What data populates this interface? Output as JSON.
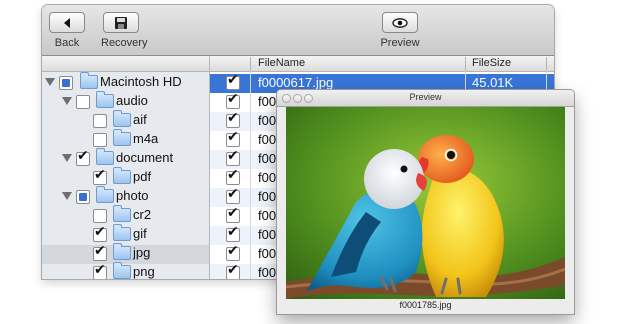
{
  "toolbar": {
    "back_label": "Back",
    "recovery_label": "Recovery",
    "preview_label": "Preview"
  },
  "tree": [
    {
      "label": "Macintosh HD",
      "expanded": true,
      "check": "partial"
    },
    {
      "label": "audio",
      "expanded": true,
      "check": "none"
    },
    {
      "label": "aif",
      "check": "none"
    },
    {
      "label": "m4a",
      "check": "none"
    },
    {
      "label": "document",
      "expanded": true,
      "check": "checked"
    },
    {
      "label": "pdf",
      "check": "checked"
    },
    {
      "label": "photo",
      "expanded": true,
      "check": "partial"
    },
    {
      "label": "cr2",
      "check": "none"
    },
    {
      "label": "gif",
      "check": "checked"
    },
    {
      "label": "jpg",
      "check": "checked"
    },
    {
      "label": "png",
      "check": "checked"
    }
  ],
  "file_list": {
    "header_filename": "FileName",
    "header_filesize": "FileSize",
    "rows": [
      {
        "name": "f0000617.jpg",
        "size": "45.01K",
        "checked": true
      },
      {
        "name": "f00",
        "checked": true
      },
      {
        "name": "f00",
        "checked": true
      },
      {
        "name": "f00",
        "checked": true
      },
      {
        "name": "f00",
        "checked": true
      },
      {
        "name": "f00",
        "checked": true
      },
      {
        "name": "f00",
        "checked": true
      },
      {
        "name": "f00",
        "checked": true
      },
      {
        "name": "f00",
        "checked": true
      },
      {
        "name": "f00",
        "checked": true
      },
      {
        "name": "f00",
        "checked": true
      }
    ]
  },
  "preview": {
    "title": "Preview",
    "caption": "f0001785.jpg"
  },
  "colors": {
    "selection": "#3875d7",
    "checkbox_partial": "#3a6fd1"
  }
}
